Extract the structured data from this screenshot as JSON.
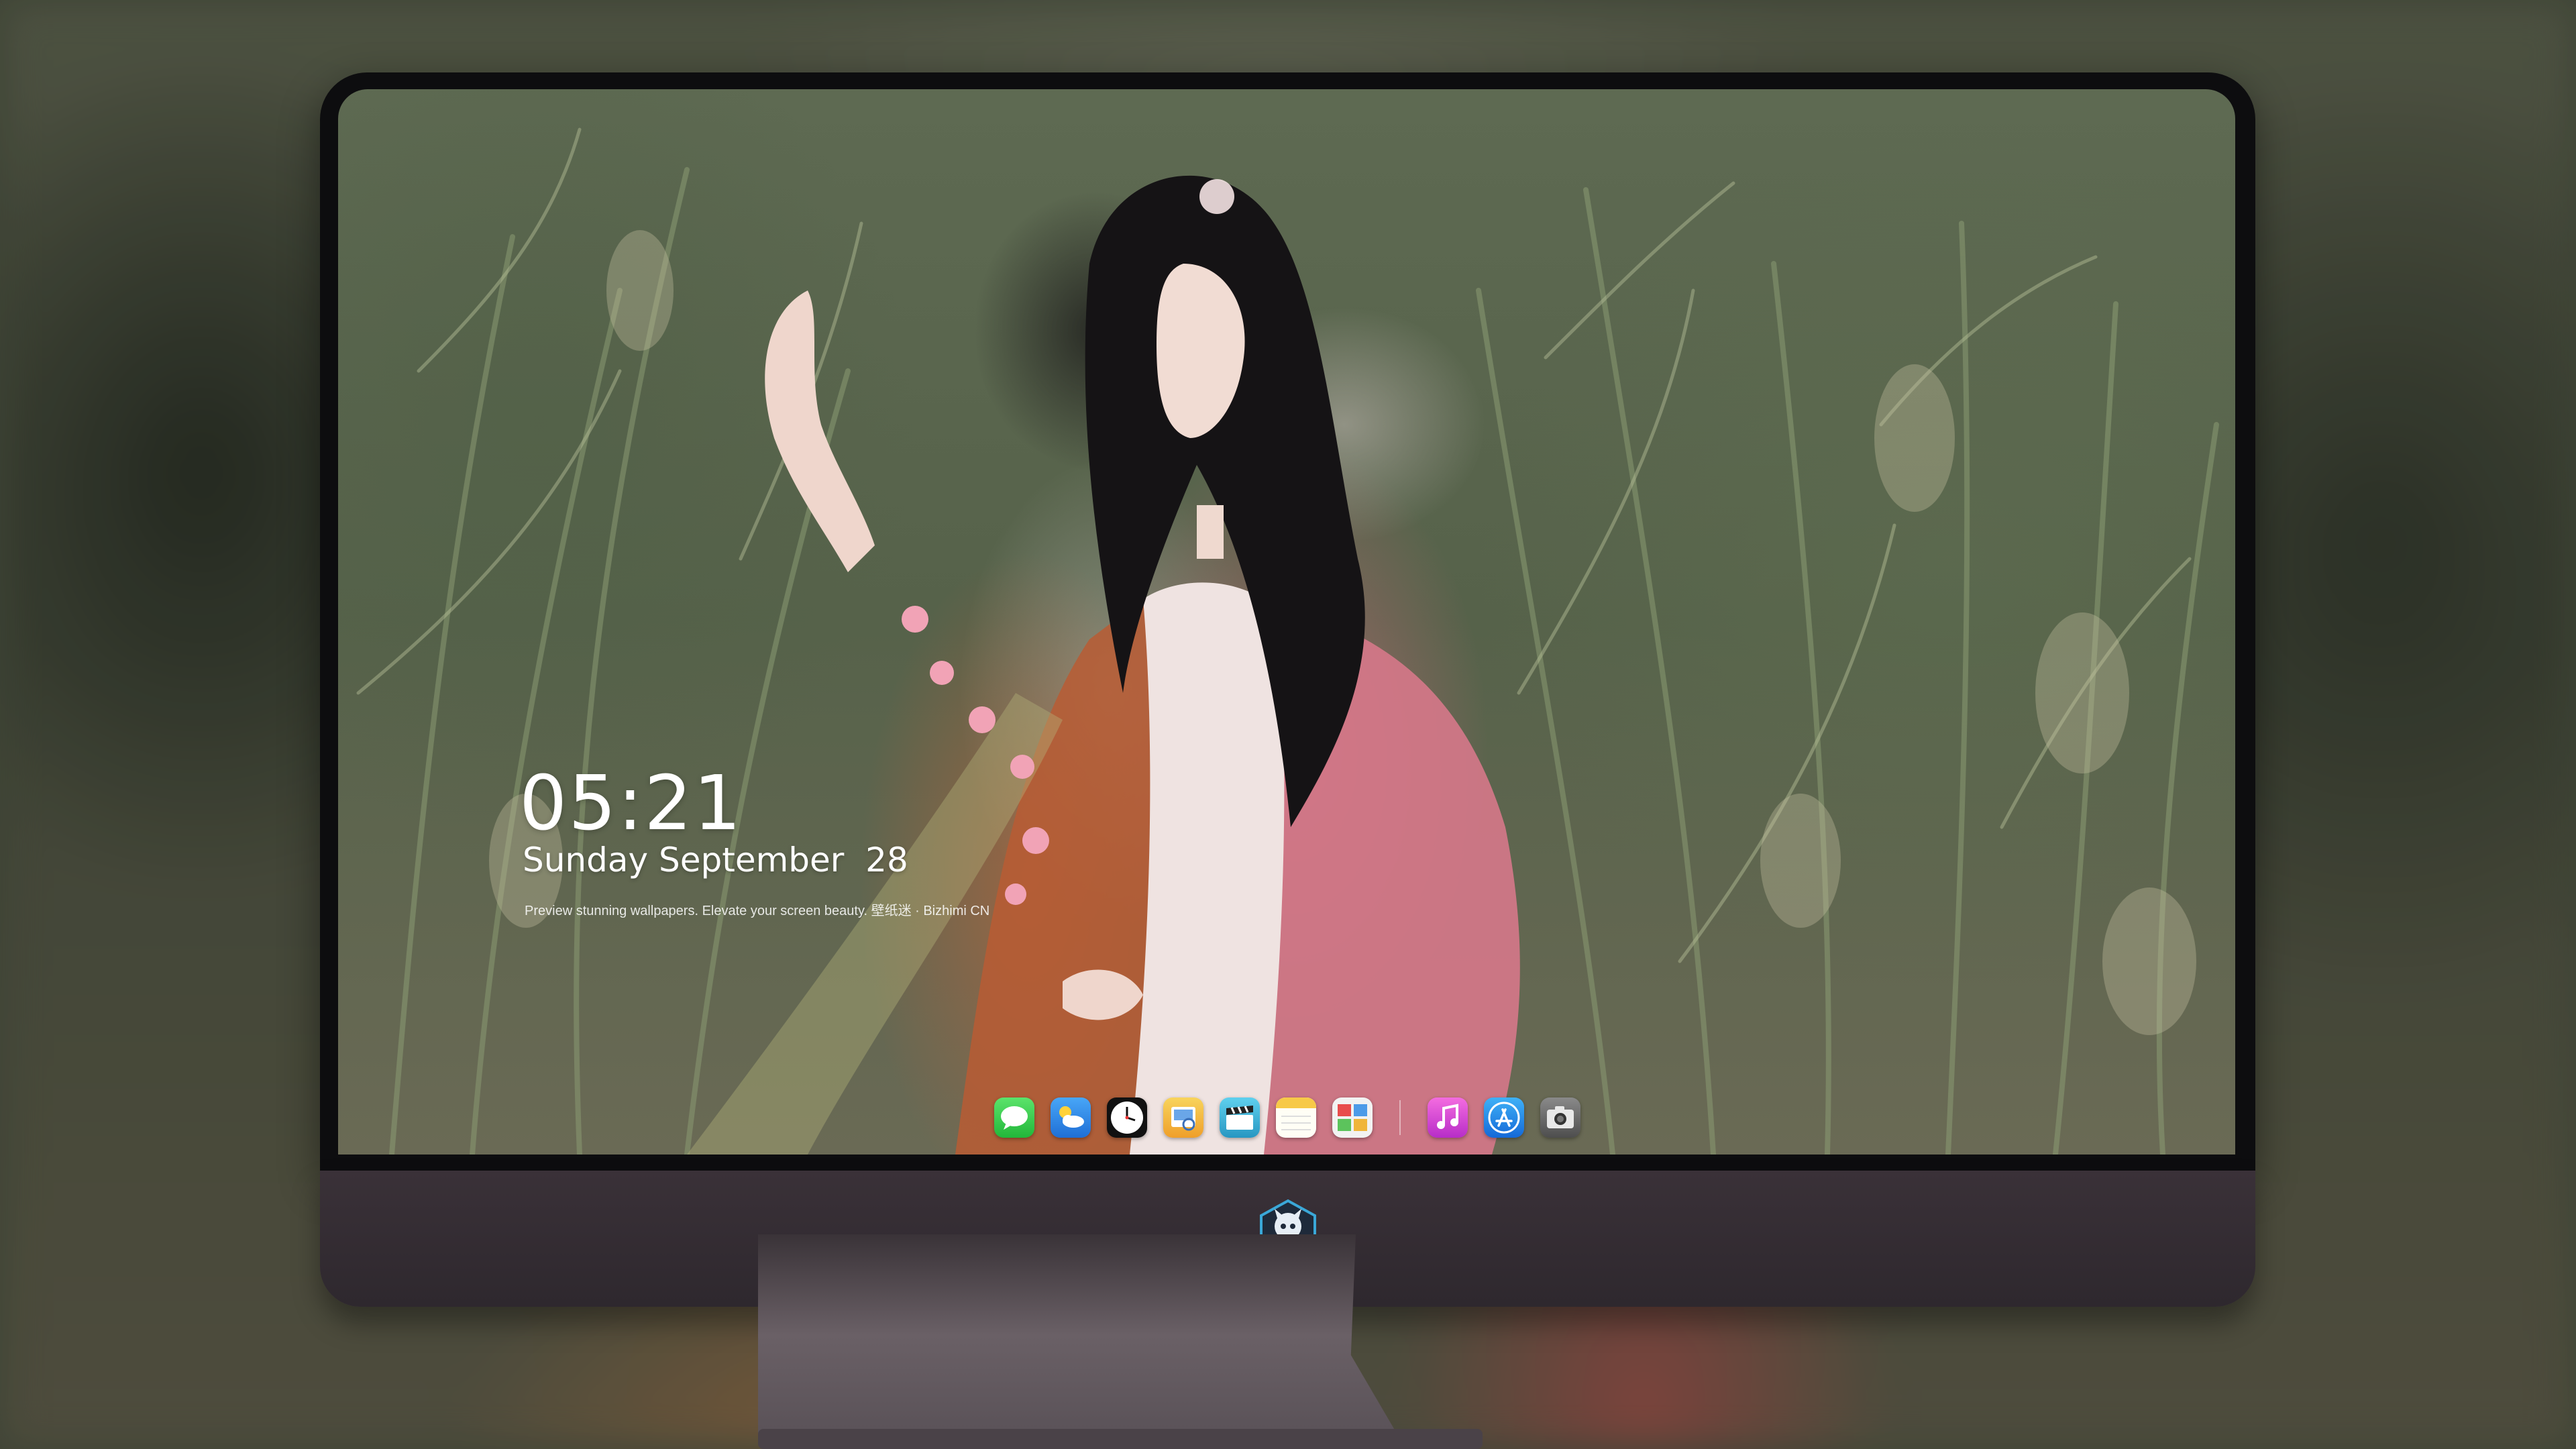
{
  "lock_screen": {
    "time": "05:21",
    "date": "Sunday September  28",
    "caption": "Preview stunning wallpapers. Elevate your screen beauty. 壁纸迷 · Bizhimi CN"
  },
  "dock": {
    "apps": [
      {
        "name": "messages",
        "icon": "messages-icon",
        "color": "#2ecc40"
      },
      {
        "name": "weather",
        "icon": "weather-icon",
        "color": "#2f8cf0"
      },
      {
        "name": "clock",
        "icon": "clock-icon",
        "color": "#111111"
      },
      {
        "name": "preview",
        "icon": "preview-icon",
        "color": "#f5b73b"
      },
      {
        "name": "final-cut",
        "icon": "clapper-icon",
        "color": "#3bb6d8"
      },
      {
        "name": "notes",
        "icon": "notes-icon",
        "color": "#fcd34d"
      },
      {
        "name": "photo-gallery",
        "icon": "gallery-icon",
        "color": "#f2f2f2"
      }
    ],
    "apps_right": [
      {
        "name": "music",
        "icon": "music-icon",
        "color": "#e63fd1"
      },
      {
        "name": "app-store",
        "icon": "app-store-icon",
        "color": "#1b8cf0"
      },
      {
        "name": "camera",
        "icon": "camera-icon",
        "color": "#6b6b6b"
      }
    ]
  },
  "colors": {
    "bezel": "#0d0d0f",
    "chin": "#3a3138",
    "stand": "#6a6066",
    "logo_accent": "#3aa8d8"
  }
}
